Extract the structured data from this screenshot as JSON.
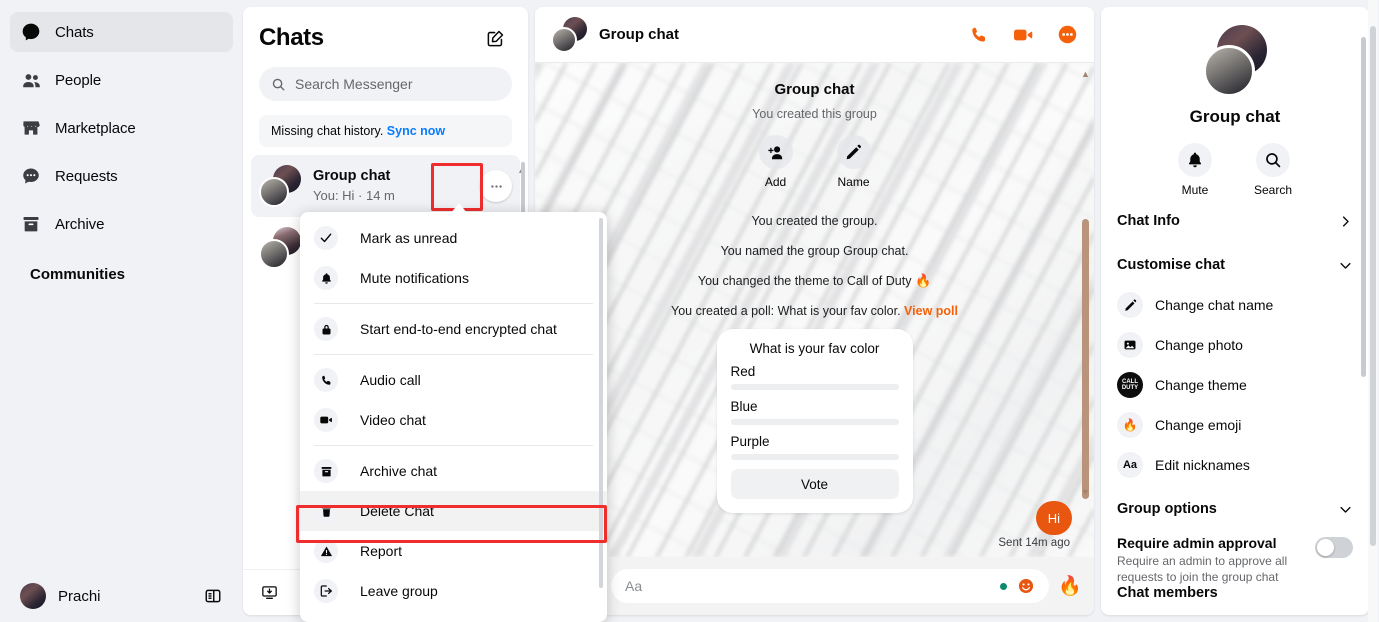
{
  "sidebar": {
    "items": [
      {
        "label": "Chats",
        "icon": "chat-bubble-icon",
        "active": true
      },
      {
        "label": "People",
        "icon": "people-icon",
        "active": false
      },
      {
        "label": "Marketplace",
        "icon": "store-icon",
        "active": false
      },
      {
        "label": "Requests",
        "icon": "message-dots-icon",
        "active": false
      },
      {
        "label": "Archive",
        "icon": "archive-box-icon",
        "active": false
      }
    ],
    "section_label": "Communities",
    "user_name": "Prachi",
    "panel_toggle_icon": "layout-panel-icon"
  },
  "chat_list": {
    "title": "Chats",
    "compose_icon": "compose-pencil-icon",
    "search_placeholder": "Search Messenger",
    "sync_banner": {
      "text": "Missing chat history.",
      "link": "Sync now"
    },
    "rows": [
      {
        "name": "Group chat",
        "preview": "You: Hi · 14 m",
        "selected": true,
        "options_icon": "more-horizontal-icon"
      }
    ],
    "bottom_icon": "install-app-icon"
  },
  "context_menu": {
    "groups": [
      [
        {
          "label": "Mark as unread",
          "icon": "check-icon"
        },
        {
          "label": "Mute notifications",
          "icon": "bell-icon"
        }
      ],
      [
        {
          "label": "Start end-to-end encrypted chat",
          "icon": "lock-icon"
        }
      ],
      [
        {
          "label": "Audio call",
          "icon": "phone-icon"
        },
        {
          "label": "Video chat",
          "icon": "video-camera-icon"
        }
      ],
      [
        {
          "label": "Archive chat",
          "icon": "archive-box-icon"
        },
        {
          "label": "Delete Chat",
          "icon": "trash-icon",
          "highlighted": true
        },
        {
          "label": "Report",
          "icon": "warning-triangle-icon"
        },
        {
          "label": "Leave group",
          "icon": "leave-arrow-icon"
        }
      ]
    ]
  },
  "conversation": {
    "header": {
      "title": "Group chat",
      "actions": [
        {
          "name": "audio-call",
          "icon": "phone-icon"
        },
        {
          "name": "video-call",
          "icon": "video-camera-icon"
        },
        {
          "name": "more-options",
          "icon": "more-circle-icon"
        }
      ]
    },
    "intro": {
      "name": "Group chat",
      "subtitle": "You created this group",
      "buttons": [
        {
          "label": "Add",
          "icon": "add-person-icon"
        },
        {
          "label": "Name",
          "icon": "pencil-icon"
        }
      ]
    },
    "system_messages": [
      {
        "text": "You created the group."
      },
      {
        "text": "You named the group Group chat."
      },
      {
        "text": "You changed the theme to Call of Duty",
        "emoji": "🔥"
      },
      {
        "text": "You created a poll: What is your fav color.",
        "link": "View poll"
      }
    ],
    "poll": {
      "question": "What is your fav color",
      "options": [
        "Red",
        "Blue",
        "Purple"
      ],
      "vote_label": "Vote"
    },
    "message": {
      "text": "Hi",
      "status": "Sent 14m ago"
    },
    "composer": {
      "placeholder": "Aa",
      "left_icons": [
        "sticker-icon",
        "gif-icon"
      ],
      "right_icons": [
        "green-dot-indicator",
        "emoji-smiley-icon"
      ],
      "quick_emoji": "🔥"
    }
  },
  "info_panel": {
    "name": "Group chat",
    "actions": [
      {
        "label": "Mute",
        "icon": "bell-icon"
      },
      {
        "label": "Search",
        "icon": "search-icon"
      }
    ],
    "sections": [
      {
        "label": "Chat Info",
        "chevron": "chevron-right-icon"
      },
      {
        "label": "Customise chat",
        "chevron": "chevron-down-icon"
      }
    ],
    "customise_items": [
      {
        "label": "Change chat name",
        "icon": "pencil-icon"
      },
      {
        "label": "Change photo",
        "icon": "photo-icon"
      },
      {
        "label": "Change theme",
        "icon": "call-of-duty-icon"
      },
      {
        "label": "Change emoji",
        "icon": "flame-emoji-icon"
      },
      {
        "label": "Edit nicknames",
        "icon": "aa-text-icon"
      }
    ],
    "group_options": {
      "label": "Group options",
      "chevron": "chevron-down-icon"
    },
    "admin_approval": {
      "title": "Require admin approval",
      "description": "Require an admin to approve all requests to join the group chat",
      "enabled": false
    },
    "cut_off_item": "Chat members"
  },
  "colors": {
    "accent_orange": "#f5610a",
    "bubble_orange": "#e8560f",
    "link_blue": "#0a7cff",
    "highlight_red": "#f02d2d",
    "page_bg": "#f0f2f5"
  }
}
